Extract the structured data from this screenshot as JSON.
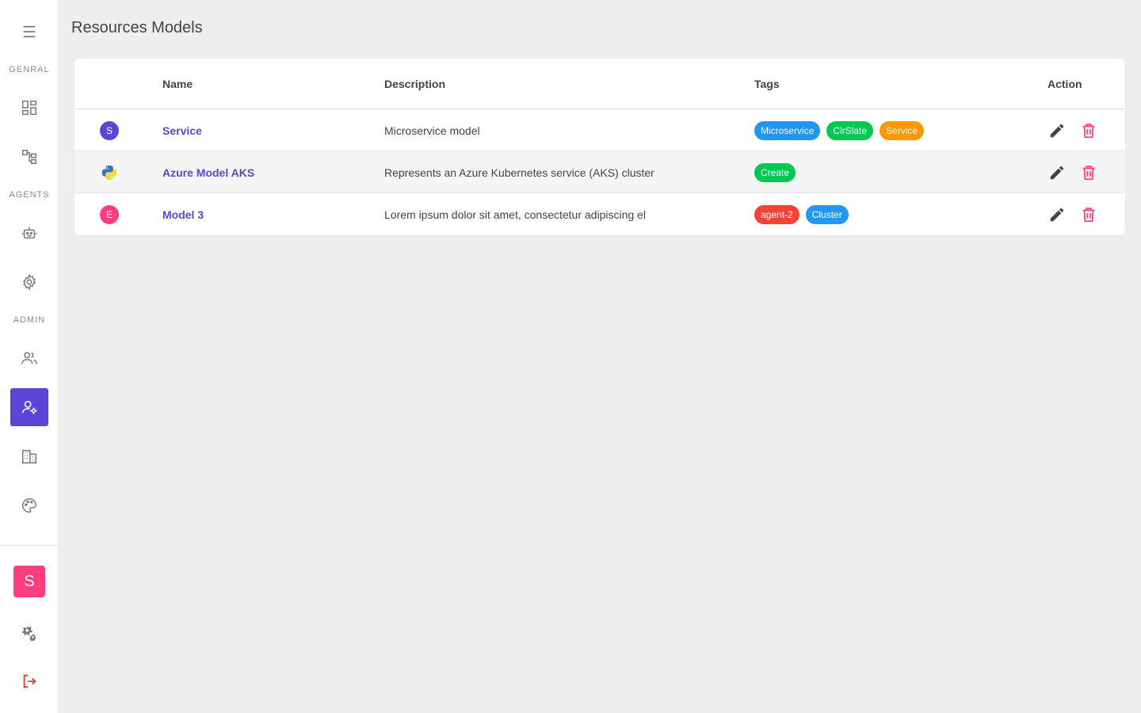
{
  "page": {
    "title": "Resources Models"
  },
  "sidebar": {
    "sections": {
      "general": "GENRAL",
      "agents": "AGENTS",
      "admin": "ADMIN"
    },
    "items": [
      {
        "name": "menu-icon"
      },
      {
        "name": "dashboard-icon"
      },
      {
        "name": "hierarchy-icon"
      },
      {
        "name": "robot-icon"
      },
      {
        "name": "settings-icon"
      },
      {
        "name": "users-icon"
      },
      {
        "name": "user-settings-icon",
        "active": true
      },
      {
        "name": "building-icon"
      },
      {
        "name": "palette-icon"
      }
    ],
    "user_avatar": "S"
  },
  "table": {
    "headers": {
      "name": "Name",
      "description": "Description",
      "tags": "Tags",
      "action": "Action"
    },
    "rows": [
      {
        "icon_letter": "S",
        "icon_color": "#5b45d9",
        "name": "Service",
        "description": "Microservice model",
        "tags": [
          {
            "label": "Microservice",
            "color": "#2196f3"
          },
          {
            "label": "ClrSlate",
            "color": "#00c853"
          },
          {
            "label": "Service",
            "color": "#ff9800"
          }
        ]
      },
      {
        "icon_letter": "",
        "icon_type": "python-icon",
        "name": "Azure Model AKS",
        "description": "Represents an Azure Kubernetes service (AKS) cluster",
        "tags": [
          {
            "label": "Create",
            "color": "#00c853"
          }
        ]
      },
      {
        "icon_letter": "E",
        "icon_color": "#ff3d7f",
        "name": "Model 3",
        "description": "Lorem ipsum dolor sit amet, consectetur adipiscing el",
        "tags": [
          {
            "label": "agent-2",
            "color": "#f44336"
          },
          {
            "label": "Cluster",
            "color": "#2196f3"
          }
        ]
      }
    ]
  },
  "colors": {
    "accent": "#5b45d9",
    "delete": "#ff3d7f",
    "logout": "#e53935",
    "background": "#eeeeee"
  }
}
